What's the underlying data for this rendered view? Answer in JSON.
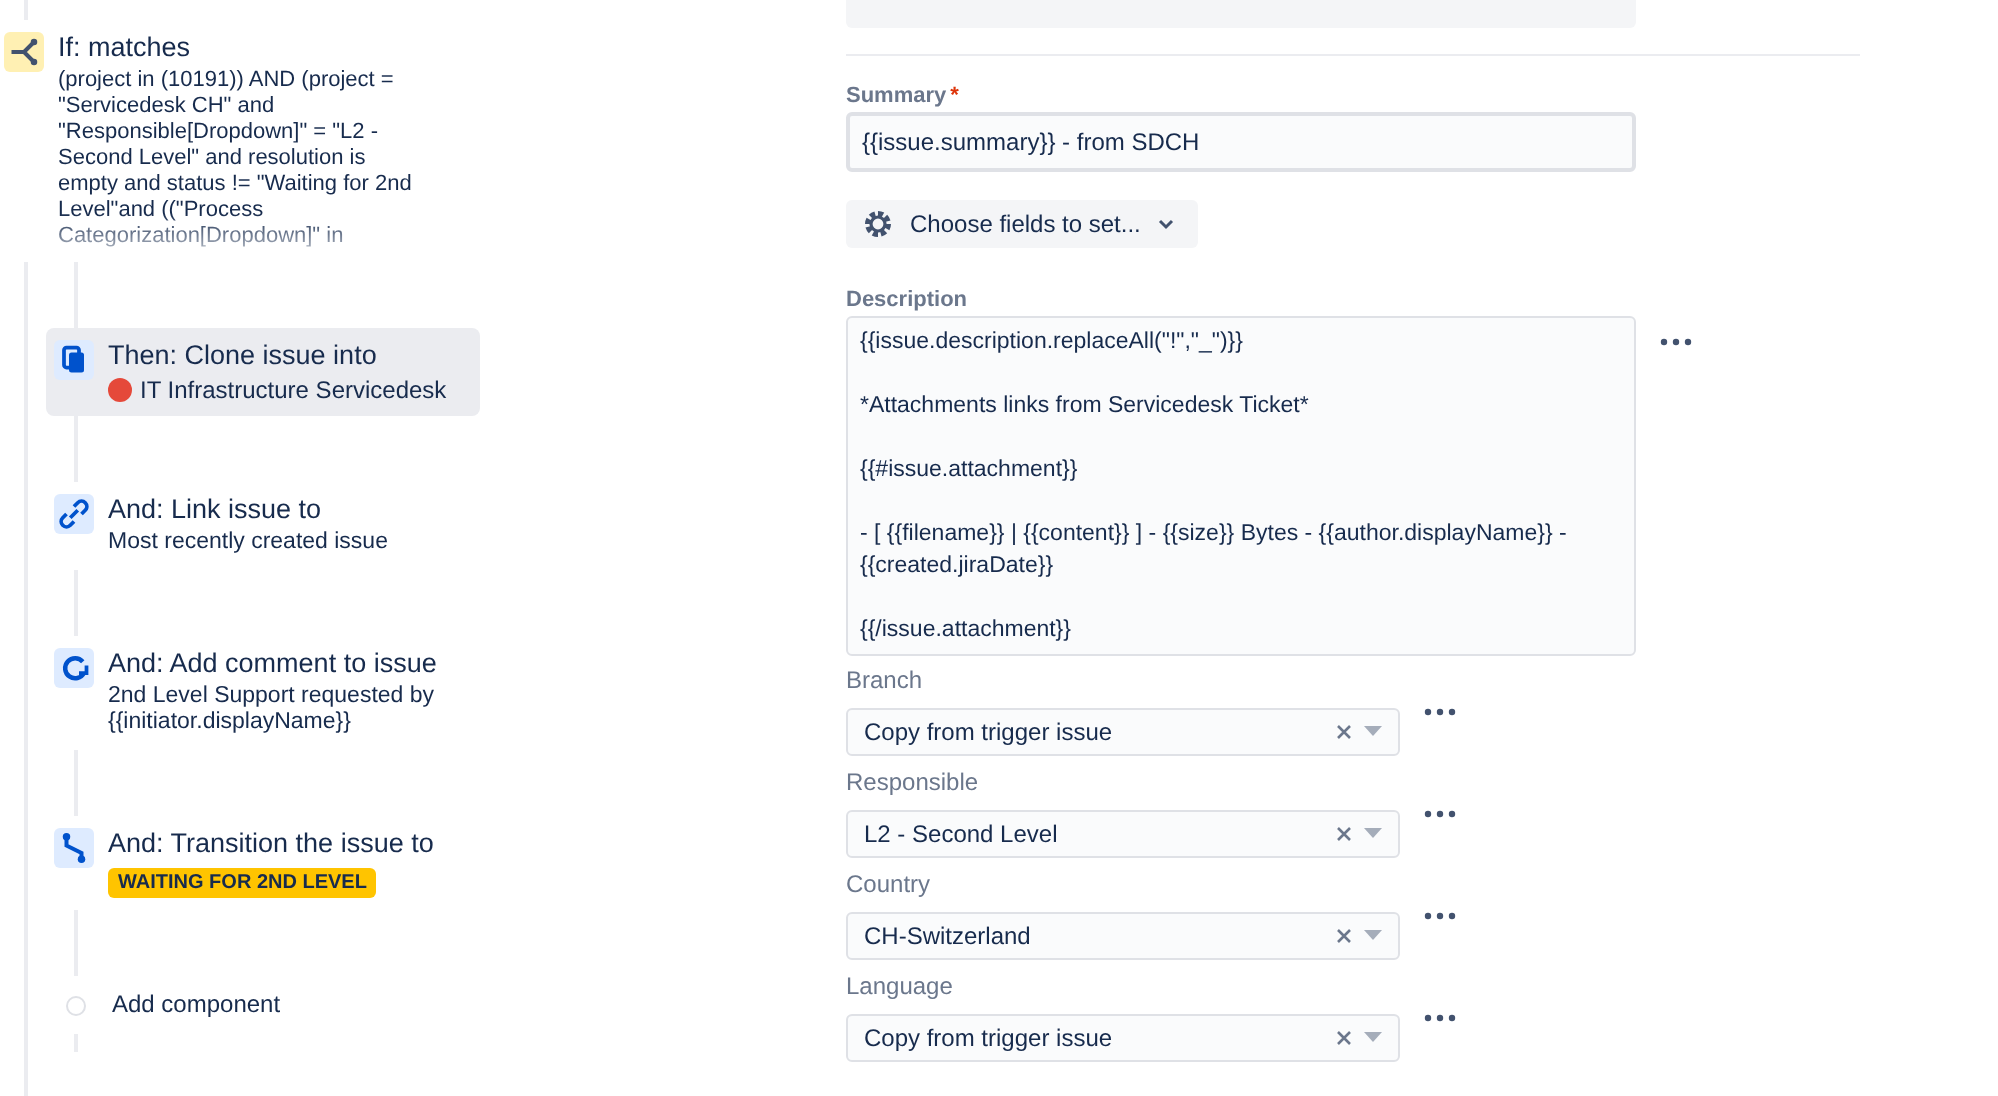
{
  "steps": [
    {
      "kind": "condition",
      "title": "If: matches",
      "selected": false,
      "detail": {
        "kind": "text",
        "text": "(project in (10191)) AND (project = \"Servicedesk CH\" and \"Responsible[Dropdown]\" = \"L2 - Second Level\" and resolution is empty and status != \"Waiting for 2nd Level\"and ((\"Process Categorization[Dropdown]\" in",
        "faded": true
      }
    },
    {
      "kind": "clone",
      "title": "Then: Clone issue into",
      "selected": true,
      "detail": {
        "kind": "project",
        "text": "IT Infrastructure Servicedesk"
      }
    },
    {
      "kind": "link",
      "title": "And: Link issue to",
      "selected": false,
      "detail": {
        "kind": "text",
        "text": "Most recently created issue"
      }
    },
    {
      "kind": "comment",
      "title": "And: Add comment to issue",
      "selected": false,
      "detail": {
        "kind": "text",
        "text": "2nd Level Support requested by {{initiator.displayName}}"
      }
    },
    {
      "kind": "transition",
      "title": "And: Transition the issue to",
      "selected": false,
      "detail": {
        "kind": "status",
        "text": "WAITING FOR 2ND LEVEL"
      }
    },
    {
      "kind": "add",
      "title": "Add component",
      "selected": false
    }
  ],
  "form": [
    {
      "kind": "text",
      "label": "Summary",
      "required_mark": "*",
      "value": "{{issue.summary}} - from SDCH"
    },
    {
      "kind": "button",
      "label": "Choose fields to set..."
    },
    {
      "kind": "textarea",
      "label": "Description",
      "paragraphs": [
        "{{issue.description.replaceAll(\"!\",\"_\")}}",
        "*Attachments links from Servicedesk Ticket*",
        "{{#issue.attachment}}",
        "- [ {{filename}} | {{content}} ] - {{size}} Bytes - {{author.displayName}} - {{created.jiraDate}}",
        "{{/issue.attachment}}"
      ]
    },
    {
      "kind": "select",
      "label": "Branch",
      "value": "Copy from trigger issue"
    },
    {
      "kind": "select",
      "label": "Responsible",
      "value": "L2 - Second Level"
    },
    {
      "kind": "select",
      "label": "Country",
      "value": "CH-Switzerland"
    },
    {
      "kind": "select",
      "label": "Language",
      "value": "Copy from trigger issue"
    }
  ]
}
